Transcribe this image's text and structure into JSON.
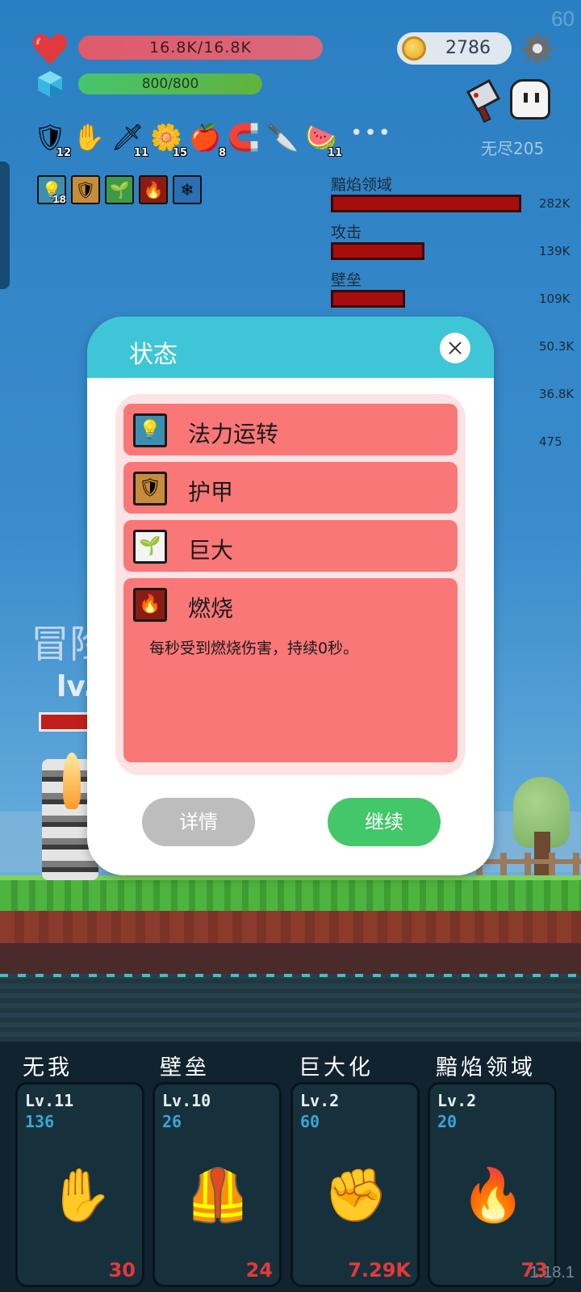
{
  "fps": "60",
  "version": "1.18.1",
  "hud": {
    "hp": "16.8K/16.8K",
    "mp": "800/800",
    "gold": "2786",
    "endless": "无尽205",
    "icons": {
      "heart": "heart-icon",
      "gem": "mana-gem-icon",
      "coin": "gold-coin-icon",
      "settings": "gear-icon"
    }
  },
  "items": [
    {
      "name": "shield-icon",
      "glyph": "🛡",
      "count": "12"
    },
    {
      "name": "glove-icon",
      "glyph": "✋",
      "count": ""
    },
    {
      "name": "sword-icon",
      "glyph": "🗡",
      "count": "11"
    },
    {
      "name": "flower-icon",
      "glyph": "🌼",
      "count": "15"
    },
    {
      "name": "apple-icon",
      "glyph": "🍎",
      "count": "8"
    },
    {
      "name": "magnet-icon",
      "glyph": "🧲",
      "count": ""
    },
    {
      "name": "blade-icon",
      "glyph": "🔪",
      "count": ""
    },
    {
      "name": "watermelon-icon",
      "glyph": "🍉",
      "count": "11"
    }
  ],
  "item_more": "•••",
  "status_icons": [
    {
      "name": "mana-flow-icon",
      "glyph": "💡",
      "count": "18",
      "bg": "#3c8fb0"
    },
    {
      "name": "armor-icon",
      "glyph": "🛡",
      "count": "",
      "bg": "#c78c3c"
    },
    {
      "name": "giant-icon",
      "glyph": "🌱",
      "count": "",
      "bg": "#3d9a4b"
    },
    {
      "name": "burn-icon",
      "glyph": "🔥",
      "count": "",
      "bg": "#8a1c14"
    },
    {
      "name": "frost-icon",
      "glyph": "❄",
      "count": "",
      "bg": "#2c6fb3"
    }
  ],
  "damage_stats": [
    {
      "label": "黯焰领域",
      "value": "282K",
      "fraction": 1.0
    },
    {
      "label": "攻击",
      "value": "139K",
      "fraction": 0.49
    },
    {
      "label": "壁垒",
      "value": "109K",
      "fraction": 0.39
    },
    {
      "label": "",
      "value": "50.3K",
      "fraction": 0.18
    },
    {
      "label": "",
      "value": "36.8K",
      "fraction": 0.13
    },
    {
      "label": "",
      "value": "475",
      "fraction": 0.01
    }
  ],
  "background": {
    "title": "冒险",
    "level": "lv."
  },
  "dialog": {
    "title": "状态",
    "rows": [
      {
        "name": "法力运转",
        "glyph": "💡",
        "bg": "#3c8fb0",
        "desc": ""
      },
      {
        "name": "护甲",
        "glyph": "🛡",
        "bg": "#c78c3c",
        "desc": ""
      },
      {
        "name": "巨大",
        "glyph": "🌱",
        "bg": "#f4f4f4",
        "desc": ""
      },
      {
        "name": "燃烧",
        "glyph": "🔥",
        "bg": "#8a1c14",
        "desc": "每秒受到燃烧伤害，持续0秒。"
      }
    ],
    "detail_button": "详情",
    "continue_button": "继续"
  },
  "skills": [
    {
      "title": "无我",
      "lv": "Lv.11",
      "num": "136",
      "cost": "30",
      "glyph": "✋",
      "icon": "eye-hand-icon"
    },
    {
      "title": "壁垒",
      "lv": "Lv.10",
      "num": "26",
      "cost": "24",
      "glyph": "🦺",
      "icon": "armor-vest-icon"
    },
    {
      "title": "巨大化",
      "lv": "Lv.2",
      "num": "60",
      "cost": "7.29K",
      "glyph": "✊",
      "icon": "fist-icon"
    },
    {
      "title": "黯焰领域",
      "lv": "Lv.2",
      "num": "20",
      "cost": "73",
      "glyph": "🔥",
      "icon": "campfire-icon"
    }
  ]
}
